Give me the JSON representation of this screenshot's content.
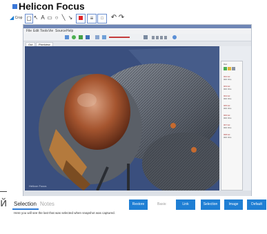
{
  "app": {
    "title": "Helicon Focus"
  },
  "toolbar": {
    "crop_label": "Crop",
    "text_tool": "A",
    "undo_glyph": "↶",
    "redo_glyph": "↷"
  },
  "window": {
    "menu": [
      "File",
      "Edit",
      "Tools",
      "Vie",
      "Source",
      "Help"
    ],
    "view_tabs": [
      "Out",
      "Pixelview"
    ]
  },
  "right_panel": {
    "rows": [
      {
        "title": "Out",
        "sub": ""
      },
      {
        "title": "002 Ad",
        "sub": "000 Obs"
      },
      {
        "title": "003 Ad",
        "sub": "000 Obs"
      },
      {
        "title": "004 Ad",
        "sub": "000 Obs"
      },
      {
        "title": "005 Ad",
        "sub": "000 Obs"
      },
      {
        "title": "006 Ad",
        "sub": "000 Obs"
      },
      {
        "title": "007 Ad",
        "sub": "000 Obs"
      },
      {
        "title": "008 Ad",
        "sub": "000 Obs"
      }
    ]
  },
  "image": {
    "watermark": "Helicon Focus"
  },
  "bottom_panel": {
    "tabs": [
      "Selection",
      "Notes"
    ],
    "active_tab": "Selection",
    "description": "Here you will see the last that was selected when snapshot was captured.",
    "buttons": {
      "restore": "Restore",
      "basis": "Basis:",
      "link": "Link",
      "selection": "Selection",
      "image": "Image",
      "default": "Default"
    }
  },
  "side": {
    "glyph": "й"
  },
  "colors": {
    "accent": "#1f7fd4",
    "image_bg": "#3a4f7e",
    "fly_eye": "#b5612f",
    "fly_body": "#6f7580"
  }
}
